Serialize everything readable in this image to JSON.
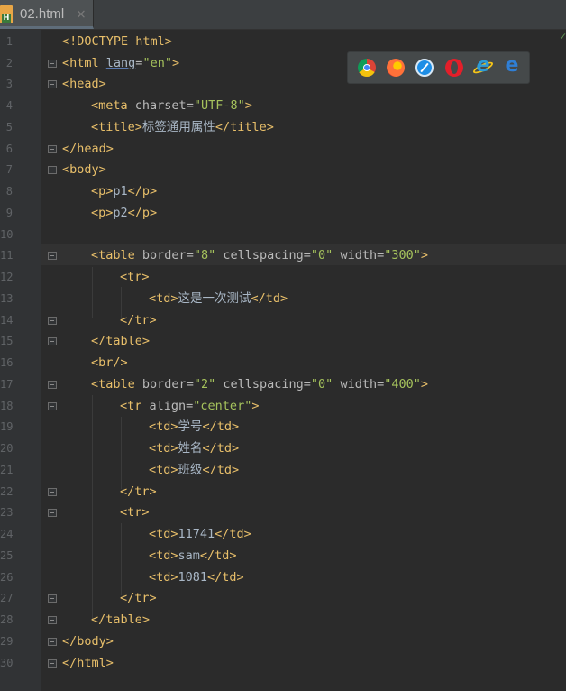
{
  "tab": {
    "label": "02.html",
    "close": "×"
  },
  "line_numbers": [
    "1",
    "2",
    "3",
    "4",
    "5",
    "6",
    "7",
    "8",
    "9",
    "10",
    "11",
    "12",
    "13",
    "14",
    "15",
    "16",
    "17",
    "18",
    "19",
    "20",
    "21",
    "22",
    "23",
    "24",
    "25",
    "26",
    "27",
    "28",
    "29",
    "30"
  ],
  "code": {
    "l1": "<!DOCTYPE html>",
    "l2": {
      "open": "<html ",
      "attr": "lang",
      "eq": "=",
      "val": "\"en\"",
      "close": ">"
    },
    "l3": "<head>",
    "l4": {
      "open": "<meta ",
      "attr": "charset",
      "eq": "=",
      "val": "\"UTF-8\"",
      "close": ">"
    },
    "l5": {
      "open": "<title>",
      "text": "标签通用属性",
      "close": "</title>"
    },
    "l6": "</head>",
    "l7": "<body>",
    "l8": {
      "open": "<p>",
      "text": "p1",
      "close": "</p>"
    },
    "l9": {
      "open": "<p>",
      "text": "p2",
      "close": "</p>"
    },
    "l11": {
      "open": "<table ",
      "a1": "border",
      "v1": "\"8\"",
      "a2": "cellspacing",
      "v2": "\"0\"",
      "a3": "width",
      "v3": "\"300\"",
      "close": ">"
    },
    "l12": "<tr>",
    "l13": {
      "open": "<td>",
      "text": "这是一次测试",
      "close": "</td>"
    },
    "l14": "</tr>",
    "l15": "</table>",
    "l16": "<br/>",
    "l17": {
      "open": "<table ",
      "a1": "border",
      "v1": "\"2\"",
      "a2": "cellspacing",
      "v2": "\"0\"",
      "a3": "width",
      "v3": "\"400\"",
      "close": ">"
    },
    "l18": {
      "open": "<tr ",
      "attr": "align",
      "eq": "=",
      "val": "\"center\"",
      "close": ">"
    },
    "l19": {
      "open": "<td>",
      "text": "学号",
      "close": "</td>"
    },
    "l20": {
      "open": "<td>",
      "text": "姓名",
      "close": "</td>"
    },
    "l21": {
      "open": "<td>",
      "text": "班级",
      "close": "</td>"
    },
    "l22": "</tr>",
    "l23": "<tr>",
    "l24": {
      "open": "<td>",
      "text": "11741",
      "close": "</td>"
    },
    "l25": {
      "open": "<td>",
      "text": "sam",
      "close": "</td>"
    },
    "l26": {
      "open": "<td>",
      "text": "1081",
      "close": "</td>"
    },
    "l27": "</tr>",
    "l28": "</table>",
    "l29": "</body>",
    "l30": "</html>"
  },
  "browsers": [
    "chrome-icon",
    "firefox-icon",
    "safari-icon",
    "opera-icon",
    "ie-icon",
    "edge-icon"
  ],
  "colors": {
    "background": "#2b2b2b",
    "tag": "#e8bf6a",
    "attr_value": "#a5c25c",
    "text": "#a9b7c6",
    "gutter": "#313335"
  }
}
